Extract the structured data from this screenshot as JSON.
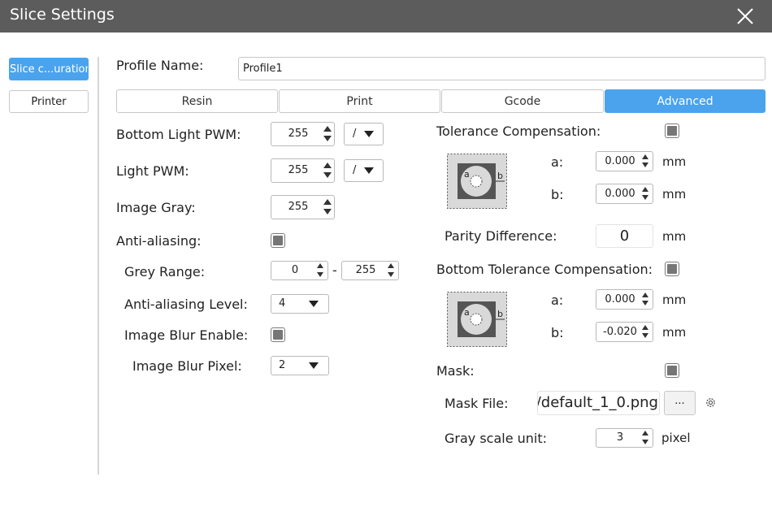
{
  "window": {
    "title": "Slice Settings",
    "close_icon": "close-icon"
  },
  "sidebar": {
    "items": [
      {
        "label": "Slice c...uration",
        "active": true
      },
      {
        "label": "Printer",
        "active": false
      }
    ]
  },
  "profile": {
    "label": "Profile Name:",
    "value": "Profile1"
  },
  "tabs": [
    {
      "label": "Resin"
    },
    {
      "label": "Print"
    },
    {
      "label": "Gcode"
    },
    {
      "label": "Advanced",
      "active": true
    }
  ],
  "left": {
    "bottom_light_pwm": {
      "label": "Bottom Light PWM:",
      "value": "255",
      "mode": "/"
    },
    "light_pwm": {
      "label": "Light PWM:",
      "value": "255",
      "mode": "/"
    },
    "image_gray": {
      "label": "Image Gray:",
      "value": "255"
    },
    "anti_aliasing": {
      "label": "Anti-aliasing:",
      "checked": true
    },
    "grey_range": {
      "label": "Grey Range:",
      "min": "0",
      "separator": "-",
      "max": "255"
    },
    "anti_aliasing_level": {
      "label": "Anti-aliasing Level:",
      "value": "4"
    },
    "image_blur_enable": {
      "label": "Image Blur Enable:",
      "checked": true
    },
    "image_blur_pixel": {
      "label": "Image Blur Pixel:",
      "value": "2"
    }
  },
  "right": {
    "tolerance": {
      "label": "Tolerance Compensation:",
      "checked": true,
      "a_label": "a:",
      "a_value": "0.000",
      "b_label": "b:",
      "b_value": "0.000",
      "unit": "mm",
      "diagram_a": "a",
      "diagram_b": "b"
    },
    "parity": {
      "label": "Parity Difference:",
      "value": "0",
      "unit": "mm"
    },
    "bottom_tolerance": {
      "label": "Bottom Tolerance Compensation:",
      "checked": true,
      "a_label": "a:",
      "a_value": "0.000",
      "b_label": "b:",
      "b_value": "-0.020",
      "unit": "mm",
      "diagram_a": "a",
      "diagram_b": "b"
    },
    "mask": {
      "label": "Mask:",
      "checked": true
    },
    "mask_file": {
      "label": "Mask File:",
      "value": "/default_1_0.png",
      "browse": "...",
      "settings_icon": "gear-icon"
    },
    "gray_scale_unit": {
      "label": "Gray scale unit:",
      "value": "3",
      "unit": "pixel"
    }
  },
  "colors": {
    "accent": "#4aa3ec",
    "titlebar": "#5c5c5c"
  }
}
